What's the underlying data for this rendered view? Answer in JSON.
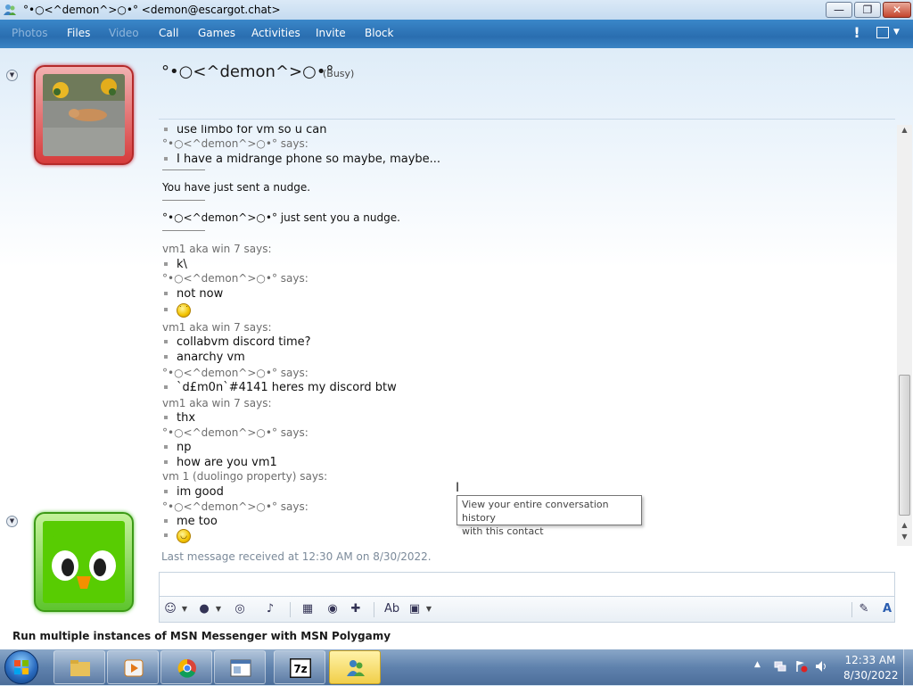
{
  "window": {
    "title": "°•○<^demon^>○•° <demon@escargot.chat>",
    "minimize_label": "—",
    "maximize_label": "❐",
    "close_label": "✕"
  },
  "menu": {
    "items": [
      {
        "label": "Photos",
        "disabled": true
      },
      {
        "label": "Files",
        "disabled": false
      },
      {
        "label": "Video",
        "disabled": true
      },
      {
        "label": "Call",
        "disabled": false
      },
      {
        "label": "Games",
        "disabled": false
      },
      {
        "label": "Activities",
        "disabled": false
      },
      {
        "label": "Invite",
        "disabled": false
      },
      {
        "label": "Block",
        "disabled": false
      }
    ],
    "alert_glyph": "!"
  },
  "contact": {
    "name": "°•○<^demon^>○•°",
    "status": "(Busy)"
  },
  "conversation": {
    "partial_top": "use limbo for vm so u can",
    "messages": [
      {
        "kind": "sender",
        "text": "°•○<^demon^>○•° says:"
      },
      {
        "kind": "msg",
        "text": "I have a midrange phone so maybe, maybe..."
      },
      {
        "kind": "sep"
      },
      {
        "kind": "sys",
        "text": "You have just sent a nudge."
      },
      {
        "kind": "sep"
      },
      {
        "kind": "sys",
        "text": "°•○<^demon^>○•° just sent you a nudge."
      },
      {
        "kind": "sep"
      },
      {
        "kind": "sender",
        "text": "vm1 aka win 7 says:"
      },
      {
        "kind": "msg",
        "text": "k\\"
      },
      {
        "kind": "sender",
        "text": "°•○<^demon^>○•° says:"
      },
      {
        "kind": "msg",
        "text": "not now"
      },
      {
        "kind": "emoji",
        "icon": "tongue-out-emoticon-icon",
        "glyph": "˙ ˙"
      },
      {
        "kind": "sender",
        "text": "vm1 aka win 7 says:"
      },
      {
        "kind": "msg",
        "text": "collabvm discord time?"
      },
      {
        "kind": "msg",
        "text": "anarchy vm"
      },
      {
        "kind": "sender",
        "text": "°•○<^demon^>○•° says:"
      },
      {
        "kind": "msg",
        "text": "`d£m0n`#4141 heres my discord btw"
      },
      {
        "kind": "sender",
        "text": "vm1 aka win 7 says:"
      },
      {
        "kind": "msg",
        "text": "thx"
      },
      {
        "kind": "sender",
        "text": "°•○<^demon^>○•° says:"
      },
      {
        "kind": "msg",
        "text": "np"
      },
      {
        "kind": "msg",
        "text": "how are you vm1"
      },
      {
        "kind": "sender",
        "text": "vm 1 (duolingo property) says:"
      },
      {
        "kind": "msg",
        "text": "im good"
      },
      {
        "kind": "sender",
        "text": "°•○<^demon^>○•° says:"
      },
      {
        "kind": "msg",
        "text": "me too"
      },
      {
        "kind": "emoji",
        "icon": "smile-emoticon-icon",
        "glyph": "◡"
      }
    ],
    "last_received": "Last message received at 12:30 AM on 8/30/2022."
  },
  "tooltip": {
    "line1": "View your entire conversation history",
    "line2": "with this contact"
  },
  "input": {
    "value": "",
    "toolbar": [
      "emoticon-icon",
      "wink-icon",
      "nudge-icon",
      "voice-clip-icon",
      "background-icon",
      "games-icon",
      "winks-icon",
      "font-icon",
      "send-files-icon",
      "handwriting-icon",
      "text-icon"
    ]
  },
  "footer": {
    "ad_text": "Run multiple instances of MSN Messenger with MSN Polygamy"
  },
  "taskbar": {
    "clock_time": "12:33 AM",
    "clock_date": "8/30/2022"
  },
  "colors": {
    "menu_bar": "#2a6eb0",
    "busy_frame": "#d63b3b",
    "online_frame": "#5ec42e"
  }
}
